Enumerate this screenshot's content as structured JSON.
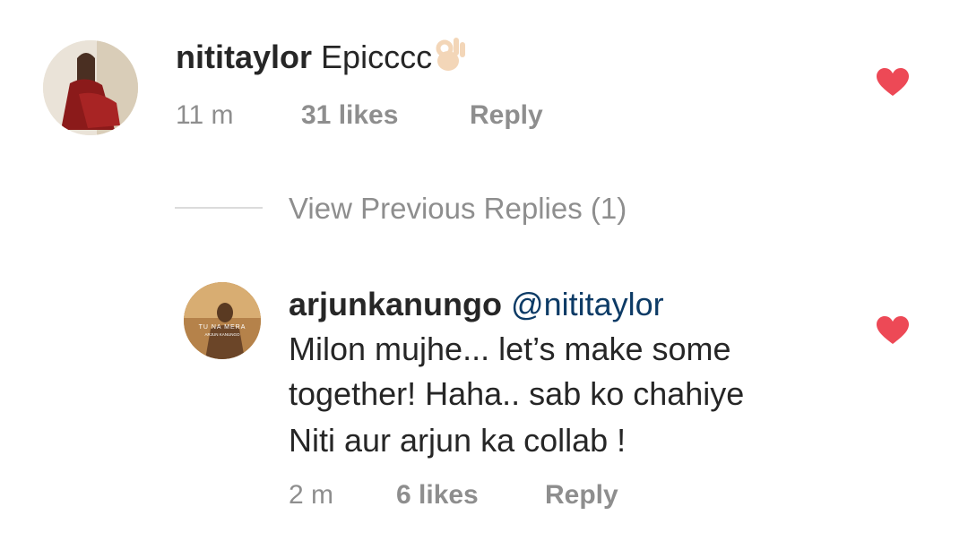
{
  "comment": {
    "username": "nititaylor",
    "text": "Epicccc",
    "emoji": "ok-hand-emoji",
    "time": "11 m",
    "likes": "31 likes",
    "reply_label": "Reply",
    "liked": true
  },
  "view_previous_replies": "View Previous Replies (1)",
  "reply": {
    "username": "arjunkanungo",
    "mention": "@nititaylor",
    "lines": [
      "Milon mujhe... let’s make some",
      "together! Haha.. sab ko chahiye",
      "Niti aur arjun ka collab !"
    ],
    "avatar_text": [
      "TU NA MERA",
      "ARJUN KANUNGO"
    ],
    "time": "2 m",
    "likes": "6 likes",
    "reply_label": "Reply",
    "liked": true
  },
  "colors": {
    "heart": "#ed4956",
    "meta_text": "#8e8e8e",
    "mention": "#0d3b66"
  }
}
